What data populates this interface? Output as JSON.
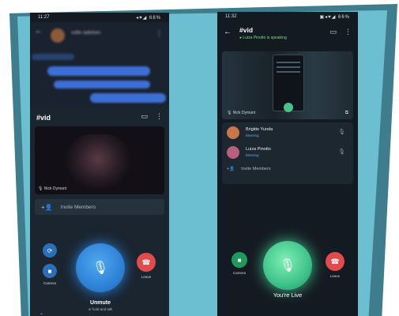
{
  "left_phone": {
    "status": {
      "time": "11:27",
      "icons": "◂♥◢ 68%"
    },
    "chat": {
      "contact_name": "sofie radelsen"
    },
    "room": {
      "title": "#vid"
    },
    "video": {
      "speaker_label": "Nick Dymant"
    },
    "invite_label": "Invite Members",
    "controls": {
      "camera_label": "Camera",
      "leave_label": "Leave",
      "unmute_label": "Unmute",
      "hold_hint": "or hold and talk"
    }
  },
  "right_phone": {
    "status": {
      "time": "11:32",
      "icons": "▣◂♥◢ 66%"
    },
    "header": {
      "title": "#vid",
      "subtitle": "Luiza Pinotto is speaking"
    },
    "video": {
      "speaker_label": "Nick Dymant"
    },
    "members": [
      {
        "name": "Brigitte Yunda",
        "status": "listening",
        "avatar_color": "#c9774a"
      },
      {
        "name": "Luiza Pinotto",
        "status": "listening",
        "avatar_color": "#b8607c"
      }
    ],
    "invite_label": "Invite Members",
    "controls": {
      "camera_label": "Camera",
      "leave_label": "Leave",
      "live_label": "You're Live"
    }
  },
  "colors": {
    "frame_dark": "#3d7d8e",
    "frame_light": "#6cbfd0",
    "unmute_blue": "#2c7fd4",
    "live_green": "#3fc38a",
    "leave_red": "#e04c4c"
  }
}
